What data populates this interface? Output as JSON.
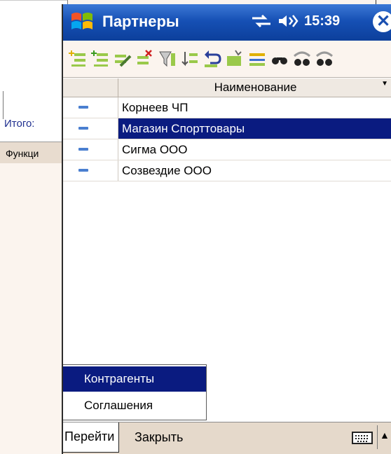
{
  "background_window": {
    "total_label": "Итого:",
    "menu_label": "Функци"
  },
  "title_bar": {
    "app_title": "Партнеры",
    "clock": "15:39",
    "close_symbol": "✕"
  },
  "toolbar": {
    "icons": [
      "add-item-icon",
      "add-subitem-icon",
      "edit-icon",
      "delete-icon",
      "filter-icon",
      "sort-icon",
      "undo-icon",
      "refresh-icon",
      "move-icon",
      "find-icon",
      "find-next-icon",
      "find-prev-icon"
    ]
  },
  "grid": {
    "column_header": "Наименование",
    "rows": [
      {
        "name": "Корнеев ЧП",
        "selected": false
      },
      {
        "name": "Магазин Спорттовары",
        "selected": true
      },
      {
        "name": "Сигма ООО",
        "selected": false
      },
      {
        "name": "Созвездие ООО",
        "selected": false
      }
    ]
  },
  "popup_menu": {
    "items": [
      {
        "label": "Контрагенты",
        "active": true
      },
      {
        "label": "Соглашения",
        "active": false
      }
    ]
  },
  "menu_bar": {
    "go_label": "Перейти",
    "close_label": "Закрыть"
  },
  "colors": {
    "title_bar": "#1650b5",
    "selection": "#0a1b80",
    "menu_bar": "#e5d9cb"
  }
}
